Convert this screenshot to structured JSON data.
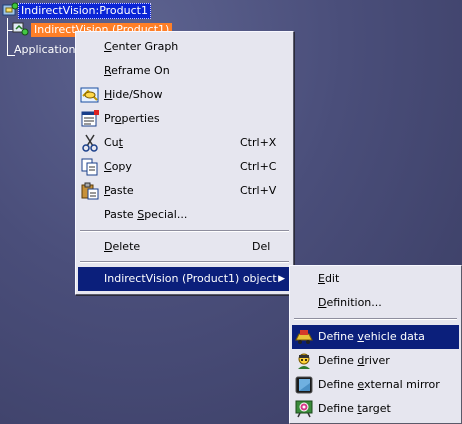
{
  "tree": {
    "root_label": "IndirectVision:Product1",
    "product_label": "IndirectVision (Product1)",
    "applications_label": "Applications"
  },
  "context_menu": {
    "items": [
      {
        "label": "Center Graph",
        "mnemonic": "C",
        "rest": "enter Graph"
      },
      {
        "label": "Reframe On",
        "mnemonic": "R",
        "rest": "eframe On"
      },
      {
        "label": "Hide/Show",
        "pre": "",
        "mnemonic": "H",
        "rest": "ide/Show",
        "icon": "hide-show-icon"
      },
      {
        "label": "Properties",
        "pre": "Pr",
        "mnemonic": "o",
        "rest": "perties",
        "icon": "properties-icon"
      },
      {
        "label": "Cut",
        "pre": "Cu",
        "mnemonic": "t",
        "rest": "",
        "shortcut": "Ctrl+X",
        "icon": "scissors-icon"
      },
      {
        "label": "Copy",
        "mnemonic": "C",
        "rest": "opy",
        "shortcut": "Ctrl+C",
        "icon": "copy-icon"
      },
      {
        "label": "Paste",
        "mnemonic": "P",
        "rest": "aste",
        "shortcut": "Ctrl+V",
        "icon": "paste-icon"
      },
      {
        "label": "Paste Special...",
        "pre": "Paste ",
        "mnemonic": "S",
        "rest": "pecial..."
      },
      {
        "label": "Delete",
        "mnemonic": "D",
        "rest": "elete",
        "shortcut": "Del"
      },
      {
        "label": "IndirectVision (Product1) object",
        "submenu_arrow": "▶"
      }
    ]
  },
  "object_submenu": {
    "items": [
      {
        "label": "Edit",
        "mnemonic": "E",
        "rest": "dit"
      },
      {
        "label": "Definition...",
        "mnemonic": "D",
        "rest": "efinition..."
      },
      {
        "label": "Define vehicle data",
        "pre": "Define ",
        "mnemonic": "v",
        "rest": "ehicle data",
        "icon": "vehicle-data-icon",
        "highlighted": true
      },
      {
        "label": "Define driver",
        "pre": "Define ",
        "mnemonic": "d",
        "rest": "river",
        "icon": "driver-icon"
      },
      {
        "label": "Define external mirror",
        "pre": "Define ",
        "mnemonic": "e",
        "rest": "xternal mirror",
        "icon": "mirror-icon"
      },
      {
        "label": "Define target",
        "pre": "Define ",
        "mnemonic": "t",
        "rest": "arget",
        "icon": "target-icon"
      }
    ]
  },
  "colors": {
    "background": "#4a4e7a",
    "menu_bg": "#e6e6ef",
    "highlight": "#0b1f7b",
    "selected_root": "#0a24d6",
    "selected_product": "#ff7f27"
  }
}
